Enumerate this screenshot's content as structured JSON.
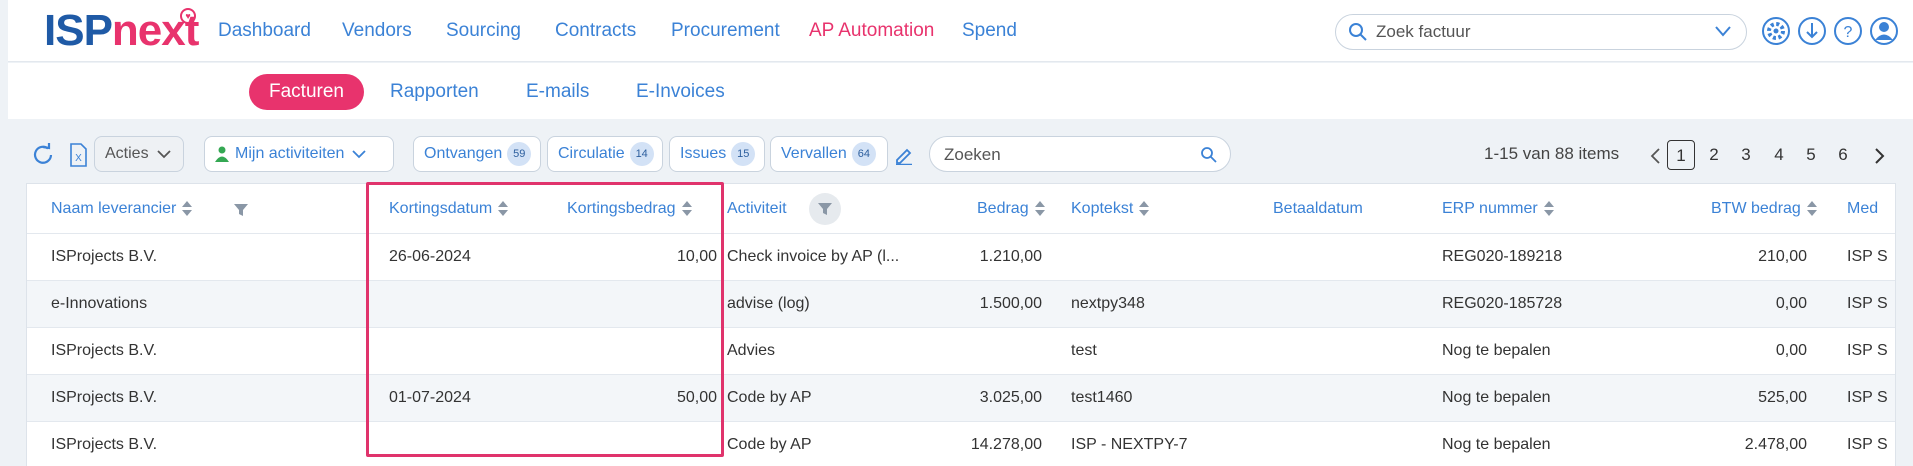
{
  "brand": {
    "logo_part1": "ISP",
    "logo_part2": "next"
  },
  "nav": [
    "Dashboard",
    "Vendors",
    "Sourcing",
    "Contracts",
    "Procurement",
    "AP Automation",
    "Spend"
  ],
  "top_search": {
    "placeholder": "Zoek factuur"
  },
  "subnav": [
    "Facturen",
    "Rapporten",
    "E-mails",
    "E-Invoices"
  ],
  "toolbar": {
    "acties_label": "Acties",
    "mijn_label": "Mijn activiteiten",
    "filters": [
      {
        "label": "Ontvangen",
        "count": "59"
      },
      {
        "label": "Circulatie",
        "count": "14"
      },
      {
        "label": "Issues",
        "count": "15"
      },
      {
        "label": "Vervallen",
        "count": "64"
      }
    ],
    "search_placeholder": "Zoeken",
    "pager_info": "1-15 van 88 items",
    "pages": [
      "1",
      "2",
      "3",
      "4",
      "5",
      "6"
    ]
  },
  "table": {
    "headers": {
      "leverancier": "Naam leverancier",
      "kortingsdatum": "Kortingsdatum",
      "kortingsbedrag": "Kortingsbedrag",
      "activiteit": "Activiteit",
      "bedrag": "Bedrag",
      "koptekst": "Koptekst",
      "betaaldatum": "Betaaldatum",
      "erp": "ERP nummer",
      "btw": "BTW bedrag",
      "med": "Med"
    },
    "rows": [
      {
        "leverancier": "ISProjects B.V.",
        "kortingsdatum": "26-06-2024",
        "kortingsbedrag": "10,00",
        "activiteit": "Check invoice by AP (l...",
        "bedrag": "1.210,00",
        "koptekst": "",
        "betaaldatum": "",
        "erp": "REG020-189218",
        "btw": "210,00",
        "med": "ISP S"
      },
      {
        "leverancier": "e-Innovations",
        "kortingsdatum": "",
        "kortingsbedrag": "",
        "activiteit": "advise (log)",
        "bedrag": "1.500,00",
        "koptekst": "nextpy348",
        "betaaldatum": "",
        "erp": "REG020-185728",
        "btw": "0,00",
        "med": "ISP S"
      },
      {
        "leverancier": "ISProjects B.V.",
        "kortingsdatum": "",
        "kortingsbedrag": "",
        "activiteit": "Advies",
        "bedrag": "",
        "koptekst": "test",
        "betaaldatum": "",
        "erp": "Nog te bepalen",
        "btw": "0,00",
        "med": "ISP S"
      },
      {
        "leverancier": "ISProjects B.V.",
        "kortingsdatum": "01-07-2024",
        "kortingsbedrag": "50,00",
        "activiteit": "Code by AP",
        "bedrag": "3.025,00",
        "koptekst": "test1460",
        "betaaldatum": "",
        "erp": "Nog te bepalen",
        "btw": "525,00",
        "med": "ISP S"
      },
      {
        "leverancier": "ISProjects B.V.",
        "kortingsdatum": "",
        "kortingsbedrag": "",
        "activiteit": "Code by AP",
        "bedrag": "14.278,00",
        "koptekst": "ISP - NEXTPY-7",
        "betaaldatum": "",
        "erp": "Nog te bepalen",
        "btw": "2.478,00",
        "med": "ISP S"
      }
    ]
  },
  "colors": {
    "brand_blue": "#1f5aa6",
    "accent_pink": "#e8336d",
    "link_blue": "#3b82d6",
    "highlight": "#e0336c"
  }
}
